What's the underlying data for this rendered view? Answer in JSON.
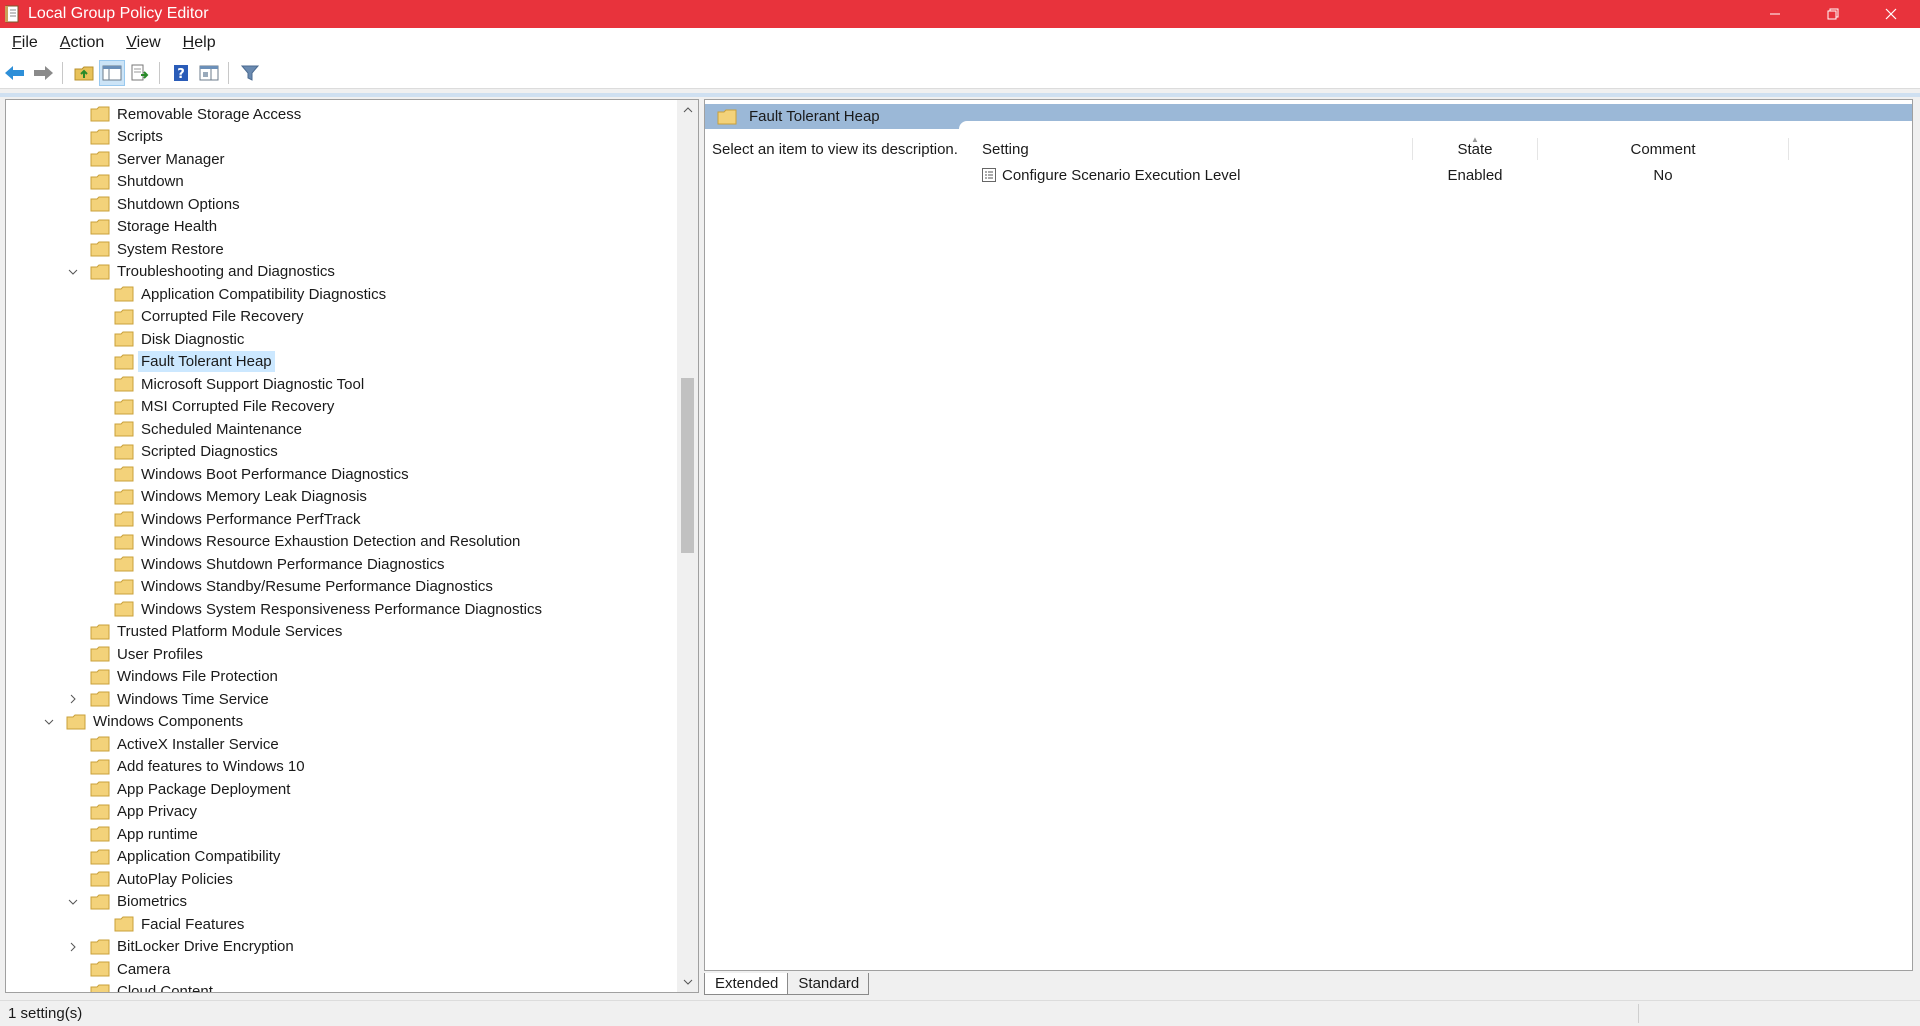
{
  "window": {
    "title": "Local Group Policy Editor",
    "controls": [
      "minimize",
      "restore",
      "close"
    ]
  },
  "menu": [
    {
      "accel": "F",
      "rest": "ile"
    },
    {
      "accel": "A",
      "rest": "ction"
    },
    {
      "accel": "V",
      "rest": "iew"
    },
    {
      "accel": "H",
      "rest": "elp"
    }
  ],
  "toolbar": {
    "buttons": [
      "back-icon",
      "forward-icon",
      "up-folder-icon",
      "show-hide-console-tree-icon",
      "export-list-icon",
      "help-icon",
      "show-action-pane-icon",
      "filter-icon"
    ]
  },
  "tree": {
    "items": [
      {
        "label": "Removable Storage Access",
        "level": 2
      },
      {
        "label": "Scripts",
        "level": 2
      },
      {
        "label": "Server Manager",
        "level": 2
      },
      {
        "label": "Shutdown",
        "level": 2
      },
      {
        "label": "Shutdown Options",
        "level": 2
      },
      {
        "label": "Storage Health",
        "level": 2
      },
      {
        "label": "System Restore",
        "level": 2
      },
      {
        "label": "Troubleshooting and Diagnostics",
        "level": 2,
        "expander": "expanded"
      },
      {
        "label": "Application Compatibility Diagnostics",
        "level": 3
      },
      {
        "label": "Corrupted File Recovery",
        "level": 3
      },
      {
        "label": "Disk Diagnostic",
        "level": 3
      },
      {
        "label": "Fault Tolerant Heap",
        "level": 3,
        "selected": true
      },
      {
        "label": "Microsoft Support Diagnostic Tool",
        "level": 3
      },
      {
        "label": "MSI Corrupted File Recovery",
        "level": 3
      },
      {
        "label": "Scheduled Maintenance",
        "level": 3
      },
      {
        "label": "Scripted Diagnostics",
        "level": 3
      },
      {
        "label": "Windows Boot Performance Diagnostics",
        "level": 3
      },
      {
        "label": "Windows Memory Leak Diagnosis",
        "level": 3
      },
      {
        "label": "Windows Performance PerfTrack",
        "level": 3
      },
      {
        "label": "Windows Resource Exhaustion Detection and Resolution",
        "level": 3
      },
      {
        "label": "Windows Shutdown Performance Diagnostics",
        "level": 3
      },
      {
        "label": "Windows Standby/Resume Performance Diagnostics",
        "level": 3
      },
      {
        "label": "Windows System Responsiveness Performance Diagnostics",
        "level": 3
      },
      {
        "label": "Trusted Platform Module Services",
        "level": 2
      },
      {
        "label": "User Profiles",
        "level": 2
      },
      {
        "label": "Windows File Protection",
        "level": 2
      },
      {
        "label": "Windows Time Service",
        "level": 2,
        "expander": "collapsed"
      },
      {
        "label": "Windows Components",
        "level": 1,
        "expander": "expanded"
      },
      {
        "label": "ActiveX Installer Service",
        "level": 2
      },
      {
        "label": "Add features to Windows 10",
        "level": 2
      },
      {
        "label": "App Package Deployment",
        "level": 2
      },
      {
        "label": "App Privacy",
        "level": 2
      },
      {
        "label": "App runtime",
        "level": 2
      },
      {
        "label": "Application Compatibility",
        "level": 2
      },
      {
        "label": "AutoPlay Policies",
        "level": 2
      },
      {
        "label": "Biometrics",
        "level": 2,
        "expander": "expanded"
      },
      {
        "label": "Facial Features",
        "level": 3
      },
      {
        "label": "BitLocker Drive Encryption",
        "level": 2,
        "expander": "collapsed"
      },
      {
        "label": "Camera",
        "level": 2
      },
      {
        "label": "Cloud Content",
        "level": 2
      }
    ]
  },
  "details": {
    "header_title": "Fault Tolerant Heap",
    "description": "Select an item to view its description.",
    "columns": {
      "setting": "Setting",
      "state": "State",
      "comment": "Comment"
    },
    "rows": [
      {
        "setting": "Configure Scenario Execution Level",
        "state": "Enabled",
        "comment": "No"
      }
    ]
  },
  "tabs": {
    "extended": "Extended",
    "standard": "Standard"
  },
  "status": {
    "text": "1 setting(s)"
  },
  "colors": {
    "titlebar": "#e8333c",
    "selection": "#cce8ff",
    "details_header": "#9bb8d7",
    "folder": "#f3d27a"
  }
}
